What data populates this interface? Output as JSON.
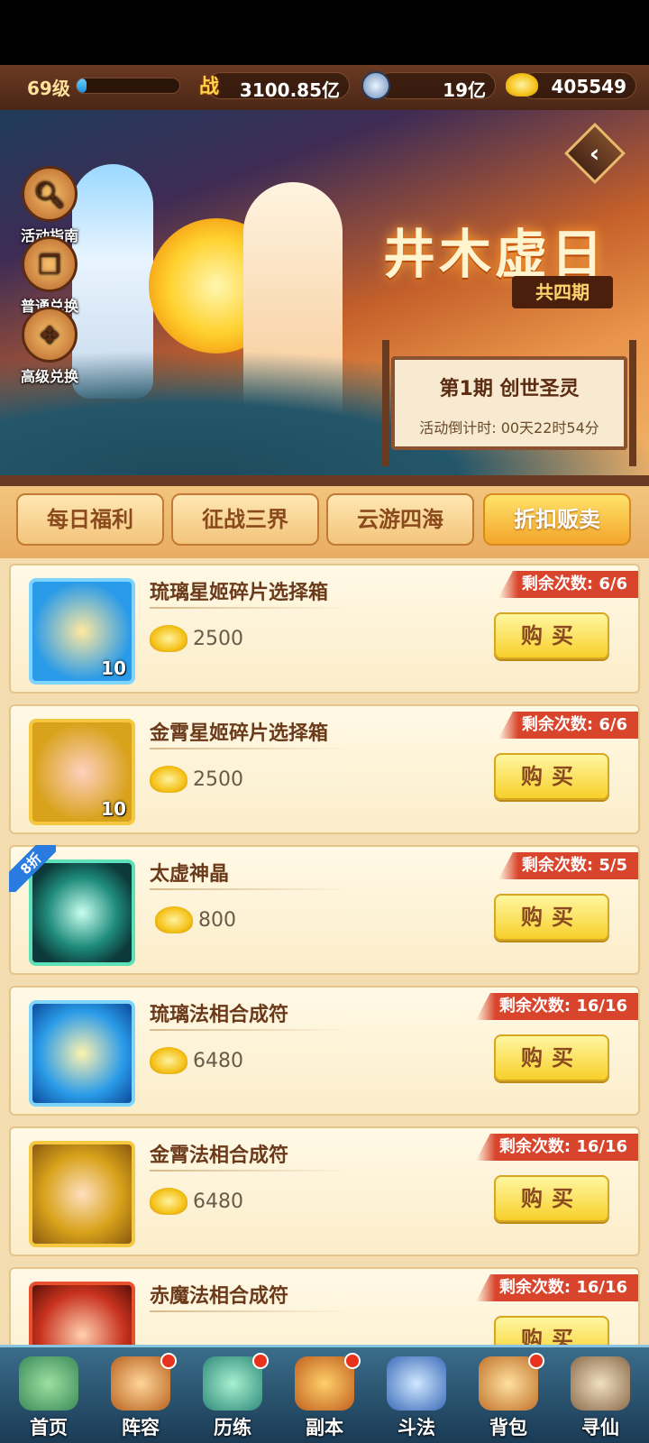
{
  "topbar": {
    "level": "69级",
    "xp_fraction": 0.1,
    "power_icon": "战",
    "power": "3100.85亿",
    "coin_icon": "coin-icon",
    "coins": "19亿",
    "gold_icon": "gold-ingot-icon",
    "gold": "405549"
  },
  "banner": {
    "side_buttons": [
      {
        "label": "活动指南",
        "icon": "magnifier-icon"
      },
      {
        "label": "普通兑换",
        "icon": "gift-box-icon"
      },
      {
        "label": "高级兑换",
        "icon": "premium-gift-icon"
      }
    ],
    "back_symbol": "‹",
    "title": "井木虚日",
    "periods": "共四期",
    "board_title": "第1期  创世圣灵",
    "countdown": "活动倒计时: 00天22时54分"
  },
  "tabs": [
    {
      "label": "每日福利",
      "active": false
    },
    {
      "label": "征战三界",
      "active": false
    },
    {
      "label": "云游四海",
      "active": false
    },
    {
      "label": "折扣贩卖",
      "active": true
    }
  ],
  "items": [
    {
      "name": "琉璃星姬碎片选择箱",
      "price": "2500",
      "remaining": "剩余次数: 6/6",
      "qty": "10",
      "discount": "",
      "buy_label": "购买",
      "color": "#2a9be8"
    },
    {
      "name": "金霄星姬碎片选择箱",
      "price": "2500",
      "remaining": "剩余次数: 6/6",
      "qty": "10",
      "discount": "",
      "buy_label": "购买",
      "color": "#d8a21a"
    },
    {
      "name": "太虚神晶",
      "price": "800",
      "remaining": "剩余次数: 5/5",
      "qty": "",
      "discount": "8折",
      "buy_label": "购买",
      "color": "#1e8a7a"
    },
    {
      "name": "琉璃法相合成符",
      "price": "6480",
      "remaining": "剩余次数: 16/16",
      "qty": "",
      "discount": "",
      "buy_label": "购买",
      "color": "#2a9be8"
    },
    {
      "name": "金霄法相合成符",
      "price": "6480",
      "remaining": "剩余次数: 16/16",
      "qty": "",
      "discount": "",
      "buy_label": "购买",
      "color": "#d8a21a"
    },
    {
      "name": "赤魔法相合成符",
      "price": "",
      "remaining": "剩余次数: 16/16",
      "qty": "",
      "discount": "",
      "buy_label": "购买",
      "color": "#c8321e"
    }
  ],
  "nav": [
    {
      "label": "首页",
      "badge": false,
      "active": false
    },
    {
      "label": "阵容",
      "badge": true,
      "active": false
    },
    {
      "label": "历练",
      "badge": true,
      "active": false
    },
    {
      "label": "副本",
      "badge": true,
      "active": true
    },
    {
      "label": "斗法",
      "badge": false,
      "active": false
    },
    {
      "label": "背包",
      "badge": true,
      "active": false
    },
    {
      "label": "寻仙",
      "badge": false,
      "active": false
    }
  ]
}
